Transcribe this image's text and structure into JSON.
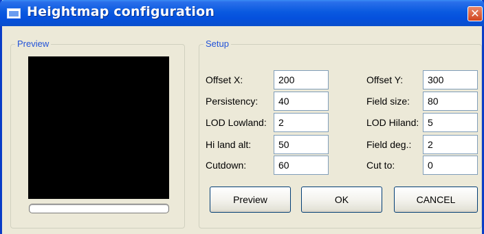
{
  "window": {
    "title": "Heightmap configuration"
  },
  "preview": {
    "group_label": "Preview"
  },
  "setup": {
    "group_label": "Setup",
    "fields_left": [
      {
        "label": "Offset X:",
        "value": "200"
      },
      {
        "label": "Persistency:",
        "value": "40"
      },
      {
        "label": "LOD Lowland:",
        "value": "2"
      },
      {
        "label": "Hi land alt:",
        "value": "50"
      },
      {
        "label": "Cutdown:",
        "value": "60"
      }
    ],
    "fields_right": [
      {
        "label": "Offset Y:",
        "value": "300"
      },
      {
        "label": "Field size:",
        "value": "80"
      },
      {
        "label": "LOD Hiland:",
        "value": "5"
      },
      {
        "label": "Field deg.:",
        "value": "2"
      },
      {
        "label": "Cut to:",
        "value": "0"
      }
    ]
  },
  "buttons": {
    "preview": "Preview",
    "ok": "OK",
    "cancel": "CANCEL"
  },
  "colors": {
    "titlebar": "#0a5ae0",
    "group_label": "#2152d8",
    "close": "#d0451f"
  }
}
